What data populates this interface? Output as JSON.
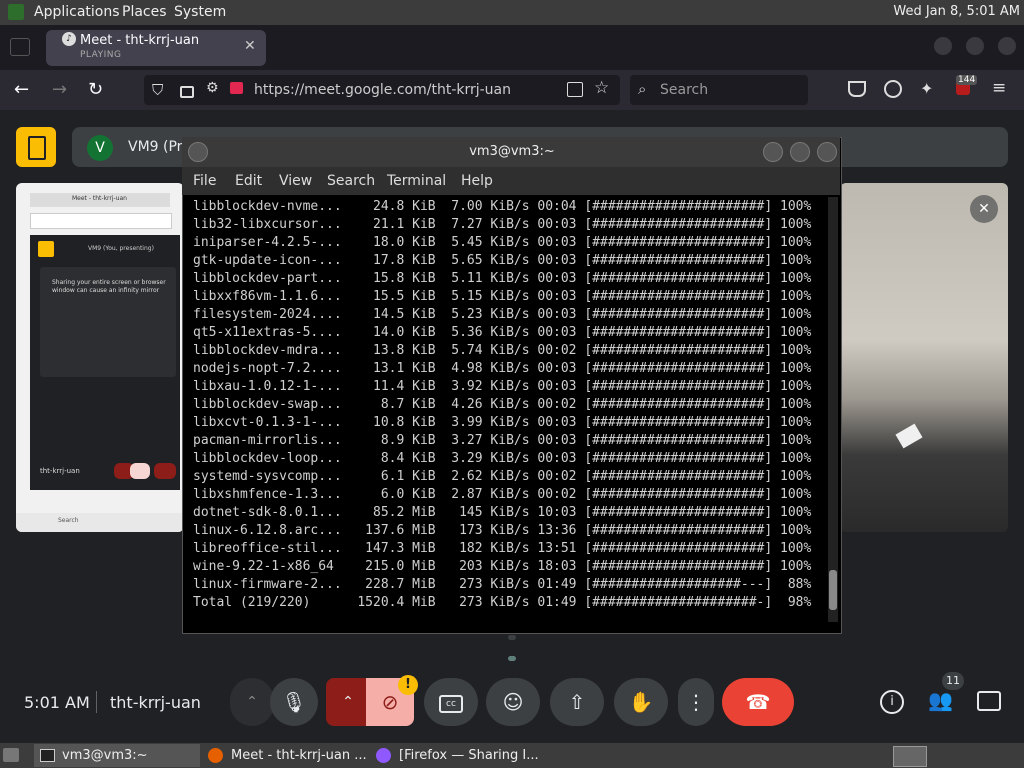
{
  "top_panel": {
    "menus": [
      "Applications",
      "Places",
      "System"
    ],
    "clock": "Wed Jan  8,  5:01 AM"
  },
  "browser": {
    "tab": {
      "title": "Meet - tht-krrj-uan",
      "subtitle": "PLAYING"
    },
    "url": "https://meet.google.com/tht-krrj-uan",
    "search_placeholder": "Search",
    "extension_badge": "144"
  },
  "meet": {
    "presenter_avatar_letter": "V",
    "presenter_name": "VM9 (Pr",
    "preview": {
      "tab_title": "Meet - tht-krrj-uan",
      "presenting_label": "VM9 (You, presenting)",
      "warning": "Sharing your entire screen or browser window can cause an infinity mirror",
      "code": "tht-krrj-uan",
      "search": "Search"
    },
    "time": "5:01 AM",
    "meeting_code": "tht-krrj-uan",
    "warning_badge": "!",
    "people_count": "11"
  },
  "terminal": {
    "title": "vm3@vm3:~",
    "menus": [
      "File",
      "Edit",
      "View",
      "Search",
      "Terminal",
      "Help"
    ],
    "lines": [
      "libblockdev-nvme...    24.8 KiB  7.00 KiB/s 00:04 [######################] 100%",
      "lib32-libxcursor...    21.1 KiB  7.27 KiB/s 00:03 [######################] 100%",
      "iniparser-4.2.5-...    18.0 KiB  5.45 KiB/s 00:03 [######################] 100%",
      "gtk-update-icon-...    17.8 KiB  5.65 KiB/s 00:03 [######################] 100%",
      "libblockdev-part...    15.8 KiB  5.11 KiB/s 00:03 [######################] 100%",
      "libxxf86vm-1.1.6...    15.5 KiB  5.15 KiB/s 00:03 [######################] 100%",
      "filesystem-2024....    14.5 KiB  5.23 KiB/s 00:03 [######################] 100%",
      "qt5-x11extras-5....    14.0 KiB  5.36 KiB/s 00:03 [######################] 100%",
      "libblockdev-mdra...    13.8 KiB  5.74 KiB/s 00:02 [######################] 100%",
      "nodejs-nopt-7.2....    13.1 KiB  4.98 KiB/s 00:03 [######################] 100%",
      "libxau-1.0.12-1-...    11.4 KiB  3.92 KiB/s 00:03 [######################] 100%",
      "libblockdev-swap...     8.7 KiB  4.26 KiB/s 00:02 [######################] 100%",
      "libxcvt-0.1.3-1-...    10.8 KiB  3.99 KiB/s 00:03 [######################] 100%",
      "pacman-mirrorlis...     8.9 KiB  3.27 KiB/s 00:03 [######################] 100%",
      "libblockdev-loop...     8.4 KiB  3.29 KiB/s 00:03 [######################] 100%",
      "systemd-sysvcomp...     6.1 KiB  2.62 KiB/s 00:02 [######################] 100%",
      "libxshmfence-1.3...     6.0 KiB  2.87 KiB/s 00:02 [######################] 100%",
      "dotnet-sdk-8.0.1...    85.2 MiB   145 KiB/s 10:03 [######################] 100%",
      "linux-6.12.8.arc...   137.6 MiB   173 KiB/s 13:36 [######################] 100%",
      "libreoffice-stil...   147.3 MiB   182 KiB/s 13:51 [######################] 100%",
      "wine-9.22-1-x86_64    215.0 MiB   203 KiB/s 18:03 [######################] 100%",
      "linux-firmware-2...   228.7 MiB   273 KiB/s 01:49 [###################---]  88%",
      "Total (219/220)      1520.4 MiB   273 KiB/s 01:49 [#####################-]  98%"
    ]
  },
  "taskbar": {
    "items": [
      "vm3@vm3:~",
      "Meet - tht-krrj-uan ...",
      "[Firefox — Sharing I..."
    ]
  },
  "colors": {
    "meet_bg": "#202124",
    "hangup": "#ea4335",
    "warning": "#fbbc04",
    "terminal_bg": "#000000"
  }
}
